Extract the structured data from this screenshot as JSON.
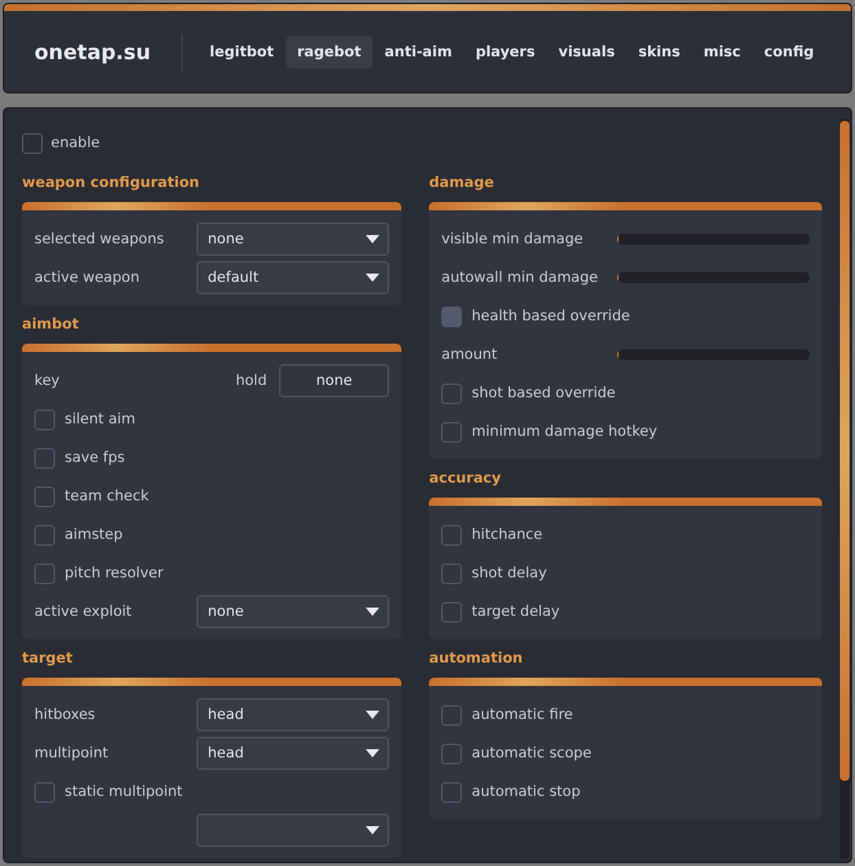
{
  "brand": "onetap.su",
  "tabs": [
    {
      "label": "legitbot",
      "selected": false
    },
    {
      "label": "ragebot",
      "selected": true
    },
    {
      "label": "anti-aim",
      "selected": false
    },
    {
      "label": "players",
      "selected": false
    },
    {
      "label": "visuals",
      "selected": false
    },
    {
      "label": "skins",
      "selected": false
    },
    {
      "label": "misc",
      "selected": false
    },
    {
      "label": "config",
      "selected": false
    }
  ],
  "enable": {
    "label": "enable",
    "checked": false
  },
  "columns": [
    [
      {
        "title": "weapon configuration",
        "rows": [
          {
            "kind": "dropdown",
            "label": "selected weapons",
            "value": "none"
          },
          {
            "kind": "dropdown",
            "label": "active weapon",
            "value": "default"
          }
        ]
      },
      {
        "title": "aimbot",
        "rows": [
          {
            "kind": "keybind",
            "label": "key",
            "mode": "hold",
            "value": "none"
          },
          {
            "kind": "checkbox",
            "label": "silent aim",
            "checked": false,
            "hovered": false
          },
          {
            "kind": "checkbox",
            "label": "save fps",
            "checked": false,
            "hovered": false
          },
          {
            "kind": "checkbox",
            "label": "team check",
            "checked": false,
            "hovered": false
          },
          {
            "kind": "checkbox",
            "label": "aimstep",
            "checked": false,
            "hovered": false
          },
          {
            "kind": "checkbox",
            "label": "pitch resolver",
            "checked": false,
            "hovered": false
          },
          {
            "kind": "dropdown",
            "label": "active exploit",
            "value": "none"
          }
        ]
      },
      {
        "title": "target",
        "rows": [
          {
            "kind": "dropdown",
            "label": "hitboxes",
            "value": "head"
          },
          {
            "kind": "dropdown",
            "label": "multipoint",
            "value": "head"
          },
          {
            "kind": "checkbox",
            "label": "static multipoint",
            "checked": false,
            "hovered": false
          },
          {
            "kind": "dropdown"
          }
        ]
      }
    ],
    [
      {
        "title": "damage",
        "rows": [
          {
            "kind": "slider",
            "label": "visible min damage",
            "level": 0
          },
          {
            "kind": "slider",
            "label": "autowall min damage",
            "level": 0
          },
          {
            "kind": "checkbox",
            "label": "health based override",
            "checked": false,
            "hovered": true
          },
          {
            "kind": "slider",
            "label": "amount",
            "level": 0
          },
          {
            "kind": "checkbox",
            "label": "shot based override",
            "checked": false,
            "hovered": false
          },
          {
            "kind": "checkbox",
            "label": "minimum damage hotkey",
            "checked": false,
            "hovered": false
          }
        ]
      },
      {
        "title": "accuracy",
        "rows": [
          {
            "kind": "checkbox",
            "label": "hitchance",
            "checked": false,
            "hovered": false
          },
          {
            "kind": "checkbox",
            "label": "shot delay",
            "checked": false,
            "hovered": false
          },
          {
            "kind": "checkbox",
            "label": "target delay",
            "checked": false,
            "hovered": false
          }
        ]
      },
      {
        "title": "automation",
        "rows": [
          {
            "kind": "checkbox",
            "label": "automatic fire",
            "checked": false,
            "hovered": false
          },
          {
            "kind": "checkbox",
            "label": "automatic scope",
            "checked": false,
            "hovered": false
          },
          {
            "kind": "checkbox",
            "label": "automatic stop",
            "checked": false,
            "hovered": false
          }
        ]
      }
    ]
  ]
}
